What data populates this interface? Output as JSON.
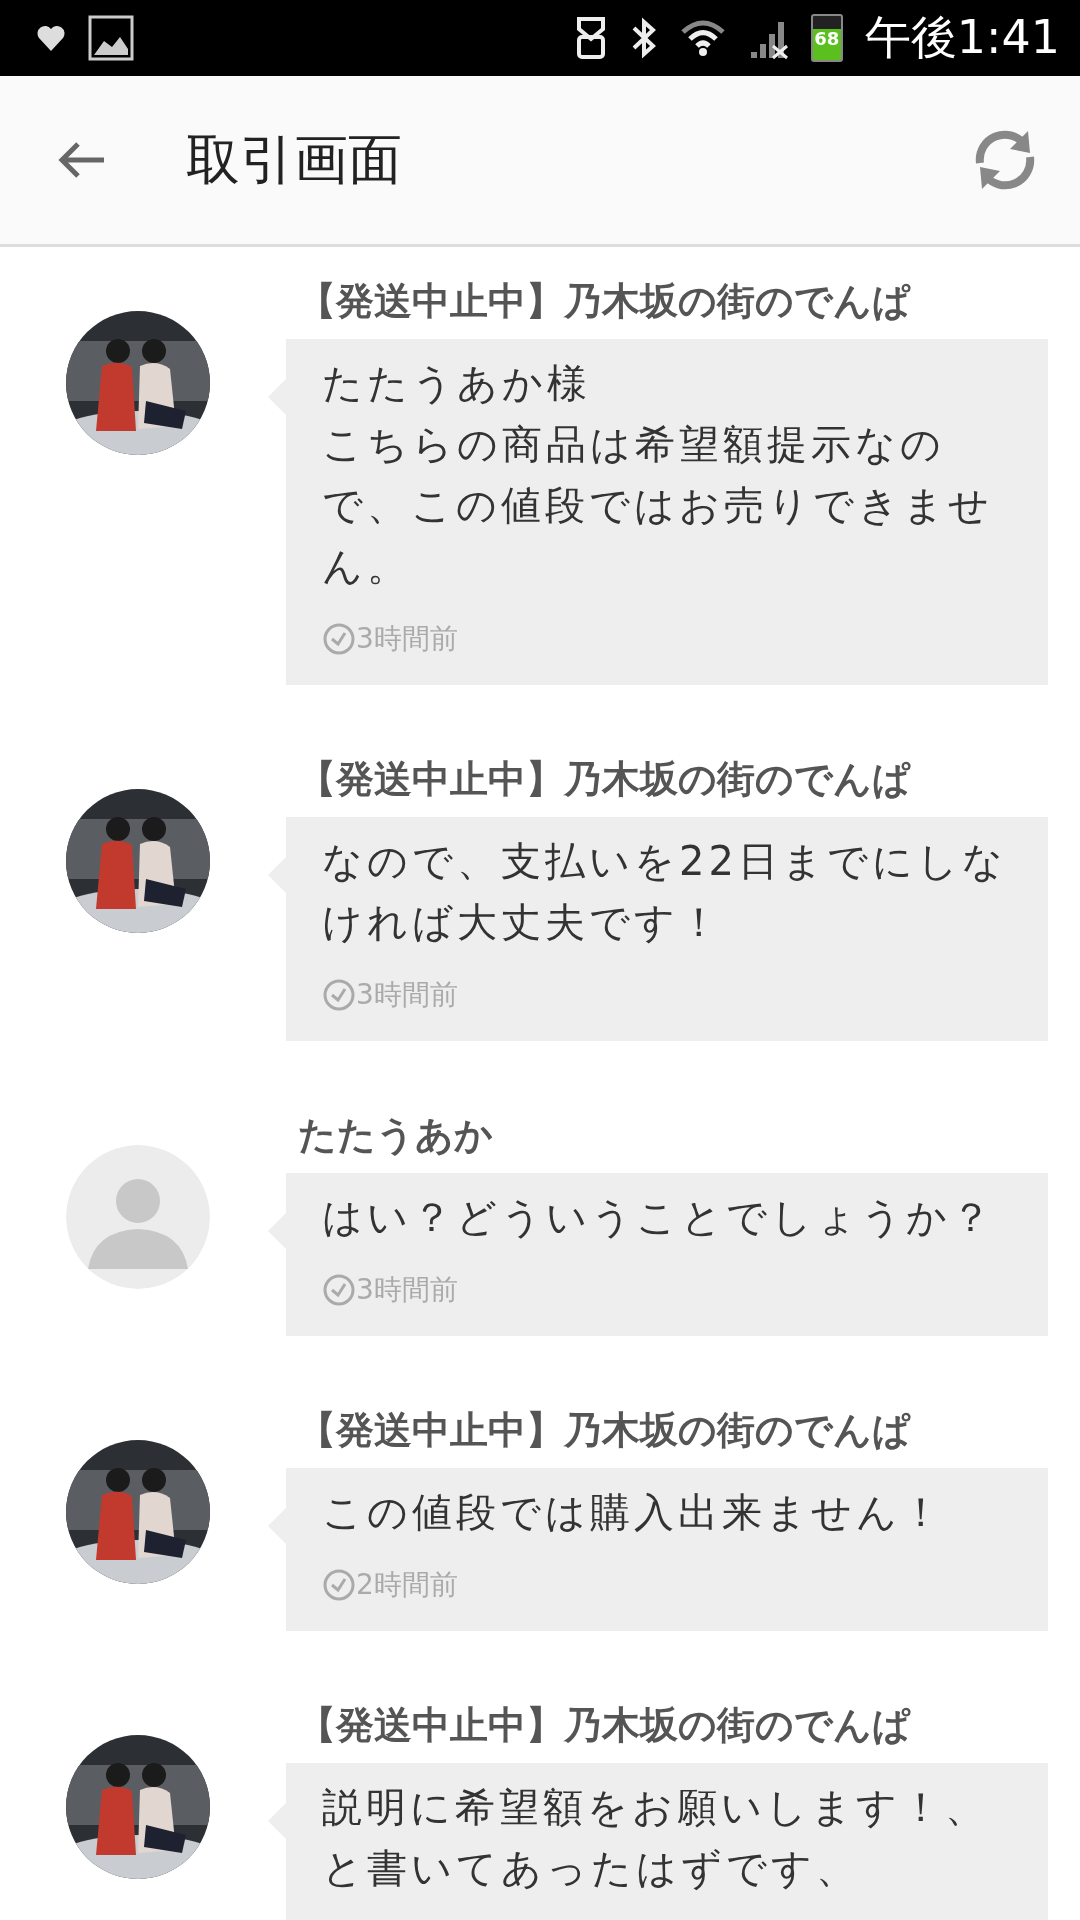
{
  "status_bar": {
    "battery": "68",
    "time": "午後1:41"
  },
  "header": {
    "title": "取引画面"
  },
  "messages": [
    {
      "sender": "【発送中止中】乃木坂の街のでんぱ",
      "avatar": {
        "kind": "picture"
      },
      "lines": [
        "たたうあか様",
        "こちらの商品は希望額提示なので、この値段ではお売りできません。"
      ],
      "time": "3時間前"
    },
    {
      "sender": "【発送中止中】乃木坂の街のでんぱ",
      "avatar": {
        "kind": "picture"
      },
      "lines": [
        "なので、支払いを22日までにしなければ大丈夫です！"
      ],
      "time": "3時間前"
    },
    {
      "sender": "たたうあか",
      "avatar": {
        "kind": "default"
      },
      "lines": [
        "はい？どういうことでしょうか？"
      ],
      "time": "3時間前"
    },
    {
      "sender": "【発送中止中】乃木坂の街のでんぱ",
      "avatar": {
        "kind": "picture"
      },
      "lines": [
        "この値段では購入出来ません！"
      ],
      "time": "2時間前"
    },
    {
      "sender": "【発送中止中】乃木坂の街のでんぱ",
      "avatar": {
        "kind": "picture"
      },
      "lines": [
        "説明に希望額をお願いします！、と書いてあったはずです、"
      ]
    }
  ]
}
